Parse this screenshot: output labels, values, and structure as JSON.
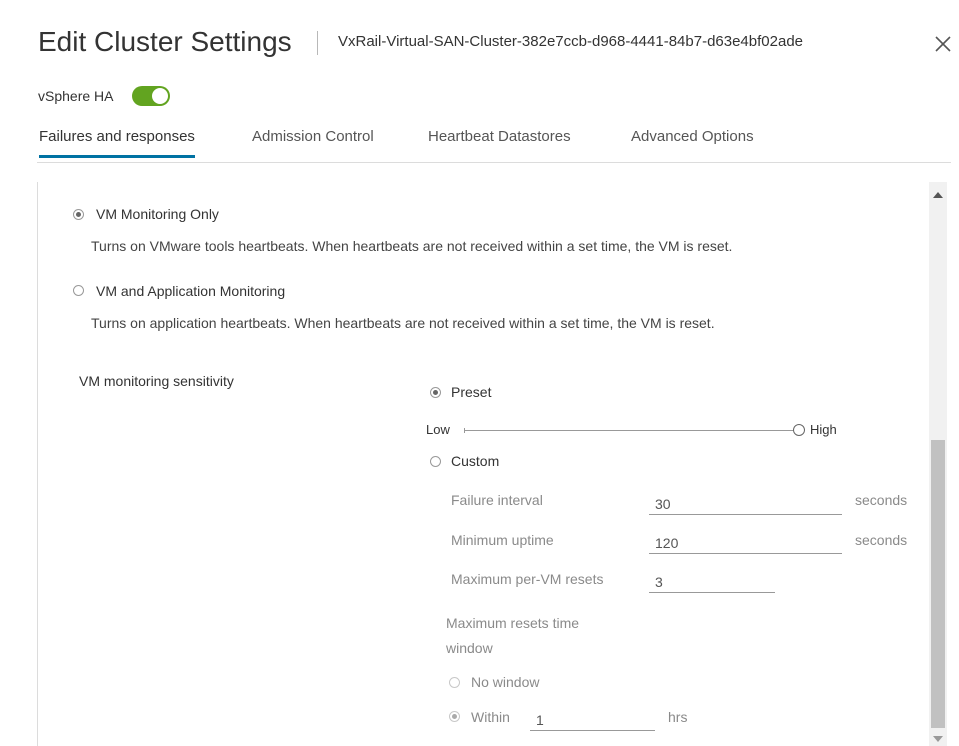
{
  "header": {
    "title": "Edit Cluster Settings",
    "subtitle": "VxRail-Virtual-SAN-Cluster-382e7ccb-d968-4441-84b7-d63e4bf02ade"
  },
  "ha": {
    "label": "vSphere HA",
    "enabled": true,
    "toggle_color": "#62a420"
  },
  "tabs": [
    {
      "label": "Failures and responses",
      "active": true
    },
    {
      "label": "Admission Control"
    },
    {
      "label": "Heartbeat Datastores"
    },
    {
      "label": "Advanced Options"
    }
  ],
  "monitoring": {
    "vm_only": {
      "label": "VM Monitoring Only",
      "selected": true,
      "description": "Turns on VMware tools heartbeats. When heartbeats are not received within a set time, the VM is reset."
    },
    "vm_app": {
      "label": "VM and Application Monitoring",
      "selected": false,
      "description": "Turns on application heartbeats. When heartbeats are not received within a set time, the VM is reset."
    }
  },
  "sensitivity": {
    "label": "VM monitoring sensitivity",
    "preset_label": "Preset",
    "preset_selected": true,
    "slider": {
      "low": "Low",
      "high": "High",
      "value": 1.0
    },
    "custom_label": "Custom",
    "custom": {
      "failure_interval": {
        "label": "Failure interval",
        "value": "30",
        "unit": "seconds"
      },
      "min_uptime": {
        "label": "Minimum uptime",
        "value": "120",
        "unit": "seconds"
      },
      "max_resets": {
        "label": "Maximum per-VM resets",
        "value": "3"
      },
      "window_label_line1": "Maximum resets time",
      "window_label_line2": "window",
      "no_window": "No window",
      "within": {
        "label": "Within",
        "value": "1",
        "unit": "hrs"
      }
    }
  },
  "colors": {
    "tab_accent": "#0072a3"
  }
}
